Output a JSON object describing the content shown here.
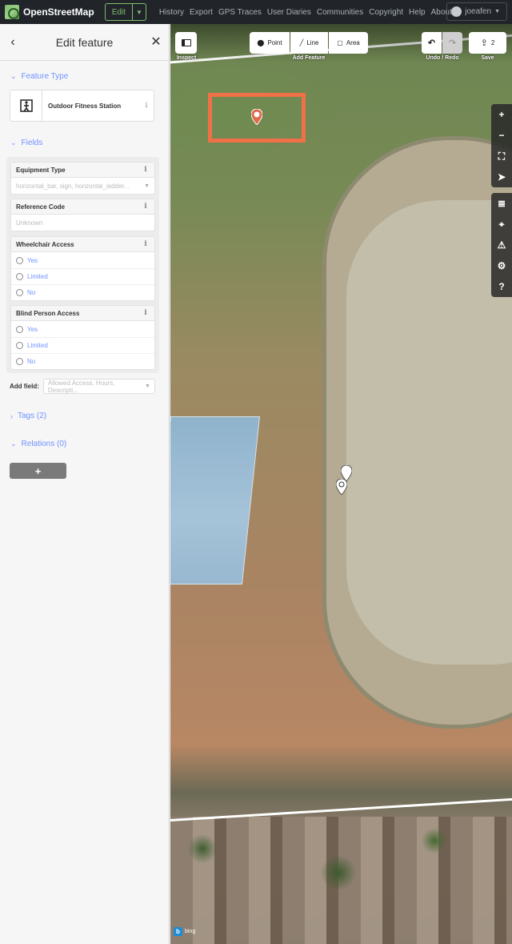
{
  "navbar": {
    "logo_text": "OpenStreetMap",
    "edit_label": "Edit",
    "links": [
      "History",
      "Export",
      "GPS Traces",
      "User Diaries",
      "Communities",
      "Copyright",
      "Help",
      "About"
    ],
    "username": "joeafen"
  },
  "sidebar": {
    "title": "Edit feature",
    "feature_type_section": "Feature Type",
    "preset_name": "Outdoor Fitness Station",
    "fields_section": "Fields",
    "fields": {
      "equipment_type": {
        "label": "Equipment Type",
        "value": "horizontal_bar, sign, horizontal_ladder..."
      },
      "reference_code": {
        "label": "Reference Code",
        "placeholder": "Unknown"
      },
      "wheelchair": {
        "label": "Wheelchair Access",
        "options": [
          "Yes",
          "Limited",
          "No"
        ]
      },
      "blind": {
        "label": "Blind Person Access",
        "options": [
          "Yes",
          "Limited",
          "No"
        ]
      }
    },
    "add_field_label": "Add field:",
    "add_field_placeholder": "Allowed Access, Hours, Descripti...",
    "tags_section": "Tags (2)",
    "relations_section": "Relations (0)",
    "add_relation_label": "+"
  },
  "map": {
    "inspect_label": "Inspect",
    "point_label": "Point",
    "line_label": "Line",
    "area_label": "Area",
    "add_feature_label": "Add Feature",
    "undo_redo_label": "Undo / Redo",
    "save_label": "Save",
    "save_count": "2",
    "attribution": "bing",
    "highlight_color": "#f07048"
  }
}
